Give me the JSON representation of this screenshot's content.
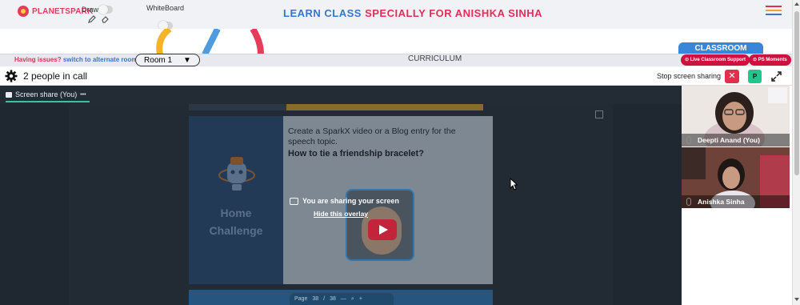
{
  "app": {
    "brand": "PLANETSPARK",
    "title_part1": "LEARN CLASS ",
    "title_part2": "SPECIALLY FOR ANISHKA SINHA",
    "draw_label": "Draw",
    "whiteboard_label": "WhiteBoard"
  },
  "roombar": {
    "issue_text": "Having issues?",
    "switch_text": "switch to alternate room",
    "room_selected": "Room 1",
    "curriculum_label": "CURRICULUM",
    "classroom_tab": "CLASSROOM",
    "live_support": "Live Classroom Support",
    "ps_moments": "PS Moments"
  },
  "call": {
    "people_text": "2 people in call",
    "stop_sharing": "Stop screen sharing",
    "stop_icon": "✕",
    "participant_initial": "P"
  },
  "stage": {
    "tab_label": "Screen share (You)",
    "tab_more": "•••",
    "slide_line1": "Create a SparkX video or a Blog entry for the speech topic.",
    "slide_line2": "How to tie a friendship bracelet?",
    "slide_home1": "Home",
    "slide_home2": "Challenge",
    "overlay_msg": "You are sharing your screen",
    "overlay_hide": "Hide this overlay",
    "pager_page": "Page",
    "pager_current": "38",
    "pager_sep": "/",
    "pager_total": "38",
    "pager_minus": "—",
    "pager_plus": "+"
  },
  "participants": [
    {
      "name": "Deepti Anand (You)"
    },
    {
      "name": "Anishka Sinha"
    }
  ],
  "colors": {
    "brand_red": "#e63c5a",
    "brand_blue": "#3876c9",
    "stop_red": "#e0304c",
    "accent_green": "#22c58b",
    "pill_red": "#d0113f"
  }
}
